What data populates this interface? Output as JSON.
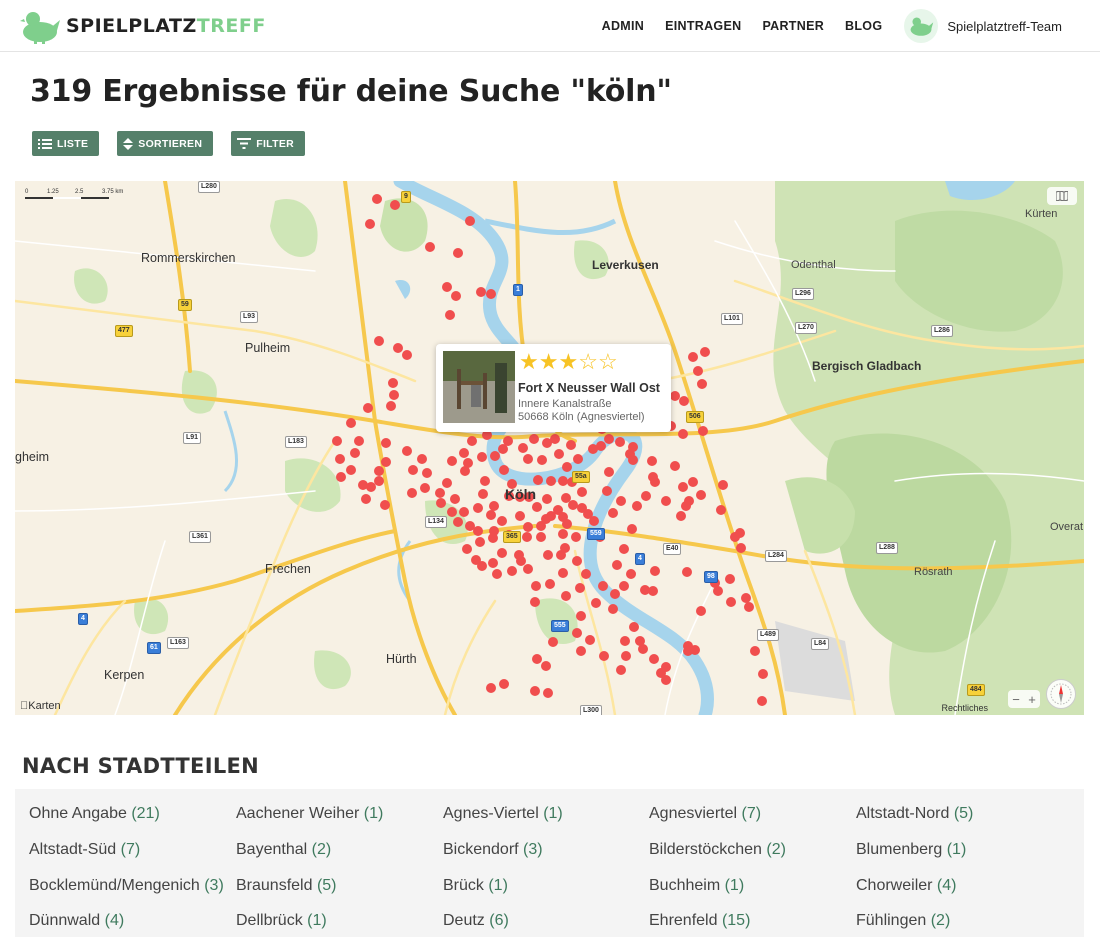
{
  "brand": {
    "name_part1": "SPIELPLATZ",
    "name_part2": "TREFF",
    "accent_color": "#7fcf8c"
  },
  "nav": {
    "items": [
      "ADMIN",
      "EINTRAGEN",
      "PARTNER",
      "BLOG"
    ],
    "user_name": "Spielplatztreff-Team"
  },
  "page_title": "319 Ergebnisse für deine Suche \"köln\"",
  "toolbar": {
    "list_label": "LISTE",
    "sort_label": "SORTIEREN",
    "filter_label": "FILTER",
    "button_color": "#55806a"
  },
  "map": {
    "scale_labels": [
      "0",
      "1.25",
      "2.5",
      "3.75 km"
    ],
    "place_labels": [
      "Rommerskirchen",
      "Leverkusen",
      "Odenthal",
      "Kürten",
      "Pulheim",
      "Bergisch Gladbach",
      "gheim",
      "Köln",
      "Frechen",
      "Hürth",
      "Kerpen",
      "Rösrath",
      "Overat"
    ],
    "road_labels": [
      "L280",
      "9",
      "1",
      "L296",
      "L101",
      "L270",
      "L286",
      "59",
      "L93",
      "477",
      "L91",
      "L183",
      "506",
      "55a",
      "L361",
      "L134",
      "365",
      "559",
      "4",
      "E40",
      "L284",
      "L288",
      "98",
      "L163",
      "61",
      "4",
      "L489",
      "L84",
      "555",
      "484",
      "L300"
    ],
    "attribution": "Karten",
    "legal": "Rechtliches",
    "marker_color": "#f04e4e",
    "popup": {
      "rating": 3,
      "max_rating": 5,
      "name": "Fort X Neusser Wall Ost",
      "street": "Innere Kanalstraße",
      "city": "50668 Köln (Agnesviertel)"
    }
  },
  "districts": {
    "title": "NACH STADTTEILEN",
    "items": [
      {
        "name": "Ohne Angabe",
        "count": "(21)"
      },
      {
        "name": "Aachener Weiher",
        "count": "(1)"
      },
      {
        "name": "Agnes-Viertel",
        "count": "(1)"
      },
      {
        "name": "Agnesviertel",
        "count": "(7)"
      },
      {
        "name": "Altstadt-Nord",
        "count": "(5)"
      },
      {
        "name": "Altstadt-Süd",
        "count": "(7)"
      },
      {
        "name": "Bayenthal",
        "count": "(2)"
      },
      {
        "name": "Bickendorf",
        "count": "(3)"
      },
      {
        "name": "Bilderstöckchen",
        "count": "(2)"
      },
      {
        "name": "Blumenberg",
        "count": "(1)"
      },
      {
        "name": "Bocklemünd/Mengenich",
        "count": "(3)"
      },
      {
        "name": "Braunsfeld",
        "count": "(5)"
      },
      {
        "name": "Brück",
        "count": "(1)"
      },
      {
        "name": "Buchheim",
        "count": "(1)"
      },
      {
        "name": "Chorweiler",
        "count": "(4)"
      },
      {
        "name": "Dünnwald",
        "count": "(4)"
      },
      {
        "name": "Dellbrück",
        "count": "(1)"
      },
      {
        "name": "Deutz",
        "count": "(6)"
      },
      {
        "name": "Ehrenfeld",
        "count": "(15)"
      },
      {
        "name": "Fühlingen",
        "count": "(2)"
      }
    ]
  }
}
